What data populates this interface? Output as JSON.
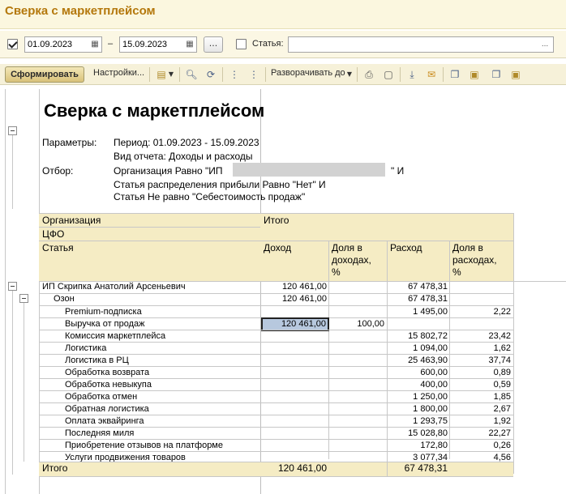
{
  "window": {
    "title": "Сверка с маркетплейсом"
  },
  "params": {
    "date_from": "01.09.2023",
    "date_separator": "–",
    "date_to": "15.09.2023",
    "period_button": "...",
    "article_label": "Статья:",
    "article_value": ""
  },
  "toolbar": {
    "generate": "Сформировать",
    "settings": "Настройки...",
    "expand_to": "Разворачивать до"
  },
  "icons": [
    "variants-icon",
    "search-icon",
    "refresh-icon",
    "group-collapse-icon",
    "group-expand-icon",
    "print-icon",
    "preview-icon",
    "save-icon",
    "mail-icon",
    "copy-icon",
    "paste-icon",
    "copy-report-icon",
    "paste-report-icon"
  ],
  "report": {
    "title": "Сверка с маркетплейсом",
    "params_label": "Параметры:",
    "period": "Период: 01.09.2023 - 15.09.2023",
    "report_kind": "Вид отчета: Доходы и расходы",
    "filter_label": "Отбор:",
    "filter_1_prefix": "Организация Равно \"ИП",
    "filter_1_suffix": "\" И",
    "filter_2": "Статья распределения прибыли Равно \"Нет\" И",
    "filter_3": "Статья Не равно \"Себестоимость продаж\"",
    "header": {
      "org": "Организация",
      "cfo": "ЦФО",
      "article": "Статья",
      "total": "Итого",
      "income": "Доход",
      "income_share": "Доля в\nдоходах,\n%",
      "expense": "Расход",
      "expense_share": "Доля в\nрасходах,\n%"
    },
    "org_row": {
      "name": "ИП Скрипка Анатолий Арсеньевич",
      "income": "120 461,00",
      "expense": "67 478,31"
    },
    "cfo_row": {
      "name": "Озон",
      "income": "120 461,00",
      "expense": "67 478,31"
    },
    "rows": [
      {
        "name": "Premium-подписка",
        "income": "",
        "income_share": "",
        "expense": "1 495,00",
        "expense_share": "2,22"
      },
      {
        "name": "Выручка от продаж",
        "income": "120 461,00",
        "income_share": "100,00",
        "expense": "",
        "expense_share": ""
      },
      {
        "name": "Комиссия маркетплейса",
        "income": "",
        "income_share": "",
        "expense": "15 802,72",
        "expense_share": "23,42"
      },
      {
        "name": "Логистика",
        "income": "",
        "income_share": "",
        "expense": "1 094,00",
        "expense_share": "1,62"
      },
      {
        "name": "Логистика в РЦ",
        "income": "",
        "income_share": "",
        "expense": "25 463,90",
        "expense_share": "37,74"
      },
      {
        "name": "Обработка возврата",
        "income": "",
        "income_share": "",
        "expense": "600,00",
        "expense_share": "0,89"
      },
      {
        "name": "Обработка невыкупа",
        "income": "",
        "income_share": "",
        "expense": "400,00",
        "expense_share": "0,59"
      },
      {
        "name": "Обработка отмен",
        "income": "",
        "income_share": "",
        "expense": "1 250,00",
        "expense_share": "1,85"
      },
      {
        "name": "Обратная логистика",
        "income": "",
        "income_share": "",
        "expense": "1 800,00",
        "expense_share": "2,67"
      },
      {
        "name": "Оплата эквайринга",
        "income": "",
        "income_share": "",
        "expense": "1 293,75",
        "expense_share": "1,92"
      },
      {
        "name": "Последняя миля",
        "income": "",
        "income_share": "",
        "expense": "15 028,80",
        "expense_share": "22,27"
      },
      {
        "name": "Приобретение отзывов на платформе",
        "income": "",
        "income_share": "",
        "expense": "172,80",
        "expense_share": "0,26"
      },
      {
        "name": "Услуги продвижения товаров",
        "income": "",
        "income_share": "",
        "expense": "3 077,34",
        "expense_share": "4,56"
      }
    ],
    "total_row": {
      "label": "Итого",
      "income": "120 461,00",
      "expense": "67 478,31"
    }
  }
}
